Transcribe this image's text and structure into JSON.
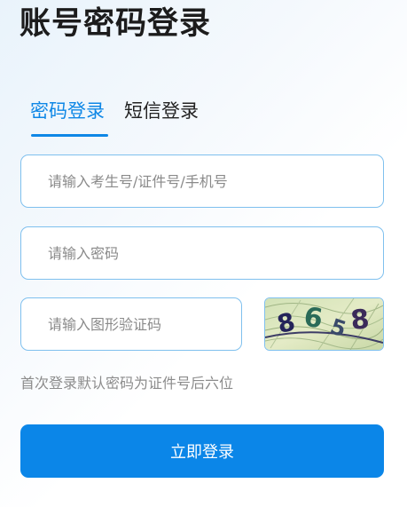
{
  "title": "账号密码登录",
  "tabs": [
    {
      "label": "密码登录",
      "active": true
    },
    {
      "label": "短信登录",
      "active": false
    }
  ],
  "fields": {
    "account": {
      "value": "",
      "placeholder": "请输入考生号/证件号/手机号"
    },
    "password": {
      "value": "",
      "placeholder": "请输入密码"
    },
    "captcha": {
      "value": "",
      "placeholder": "请输入图形验证码"
    }
  },
  "captcha_image": {
    "chars": [
      "8",
      "6",
      "5",
      "8"
    ],
    "colors": [
      "#24245a",
      "#2a6a58",
      "#3a4a6a",
      "#3a2a5a"
    ]
  },
  "hint": "首次登录默认密码为证件号后六位",
  "submit_label": "立即登录",
  "colors": {
    "accent": "#0e87e6",
    "button": "#0b86e8",
    "border": "#7fc0ee"
  }
}
